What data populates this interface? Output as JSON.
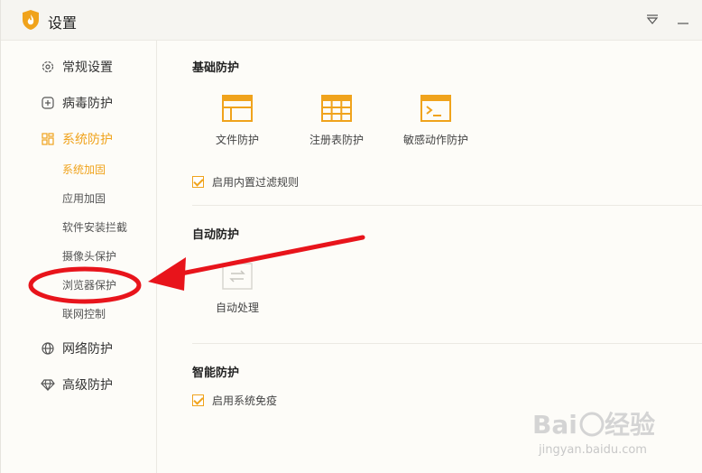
{
  "window": {
    "title": "设置",
    "brand_color": "#f0a31c"
  },
  "titlebar_buttons": [
    {
      "icon": "dropdown-menu-icon"
    },
    {
      "icon": "minimize-icon"
    }
  ],
  "sidebar": {
    "items": [
      {
        "label": "常规设置",
        "icon": "gear-icon",
        "active": false
      },
      {
        "label": "病毒防护",
        "icon": "plus-box-icon",
        "active": false
      },
      {
        "label": "系统防护",
        "icon": "grid-icon",
        "active": true
      },
      {
        "label": "网络防护",
        "icon": "globe-icon",
        "active": false
      },
      {
        "label": "高级防护",
        "icon": "diamond-icon",
        "active": false
      }
    ],
    "sub_items": [
      {
        "label": "系统加固",
        "active": true
      },
      {
        "label": "应用加固",
        "active": false
      },
      {
        "label": "软件安装拦截",
        "active": false
      },
      {
        "label": "摄像头保护",
        "active": false
      },
      {
        "label": "浏览器保护",
        "active": false
      },
      {
        "label": "联网控制",
        "active": false
      }
    ]
  },
  "main": {
    "basic": {
      "title": "基础防护",
      "tiles": [
        {
          "label": "文件防护",
          "icon": "file-window-icon"
        },
        {
          "label": "注册表防护",
          "icon": "registry-grid-icon"
        },
        {
          "label": "敏感动作防护",
          "icon": "terminal-icon"
        }
      ],
      "checkbox_label": "启用内置过滤规则",
      "checked": true
    },
    "auto": {
      "title": "自动防护",
      "tile_label": "自动处理",
      "tile_icon": "swap-arrows-icon"
    },
    "smart": {
      "title": "智能防护",
      "checkbox_label": "启用系统免疫",
      "checked": true
    }
  },
  "annotation": {
    "color": "#e8141b",
    "target": "浏览器保护"
  },
  "watermark": {
    "text": "jingyan.baidu.com"
  }
}
